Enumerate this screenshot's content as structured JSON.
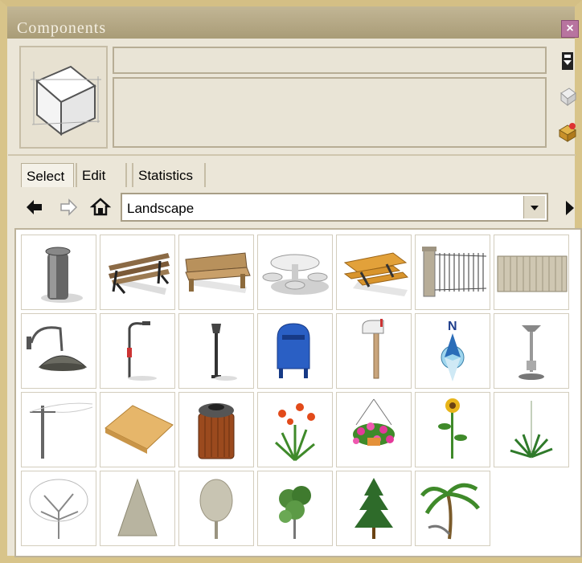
{
  "window": {
    "title": "Components",
    "close_label": "×"
  },
  "tabs": [
    {
      "label": "Select",
      "active": true
    },
    {
      "label": "Edit",
      "active": false
    },
    {
      "label": "Statistics",
      "active": false
    }
  ],
  "nav": {
    "collection": "Landscape"
  },
  "components": [
    {
      "icon": "trash-can-icon"
    },
    {
      "icon": "park-bench-iron-icon"
    },
    {
      "icon": "park-bench-wood-icon"
    },
    {
      "icon": "round-picnic-table-icon"
    },
    {
      "icon": "picnic-table-icon"
    },
    {
      "icon": "iron-fence-icon"
    },
    {
      "icon": "wood-fence-icon"
    },
    {
      "icon": "wall-lamp-icon"
    },
    {
      "icon": "street-light-icon"
    },
    {
      "icon": "lamp-post-icon"
    },
    {
      "icon": "mailbox-icon"
    },
    {
      "icon": "post-mailbox-icon"
    },
    {
      "icon": "north-arrow-icon"
    },
    {
      "icon": "patio-heater-icon"
    },
    {
      "icon": "utility-pole-icon"
    },
    {
      "icon": "rock-slab-icon"
    },
    {
      "icon": "wood-trash-bin-icon"
    },
    {
      "icon": "lily-plant-icon"
    },
    {
      "icon": "hanging-flower-basket-icon"
    },
    {
      "icon": "sunflower-icon"
    },
    {
      "icon": "grass-plant-icon"
    },
    {
      "icon": "bare-tree-icon"
    },
    {
      "icon": "conifer-tree-icon"
    },
    {
      "icon": "deciduous-tree-icon"
    },
    {
      "icon": "shrub-tree-icon"
    },
    {
      "icon": "pine-tree-icon"
    },
    {
      "icon": "palm-tree-icon"
    }
  ],
  "colors": {
    "window_border": "#d8c48a",
    "title_bar": "#b3a682",
    "panel": "#ebe6d8",
    "close": "#b8749f"
  }
}
